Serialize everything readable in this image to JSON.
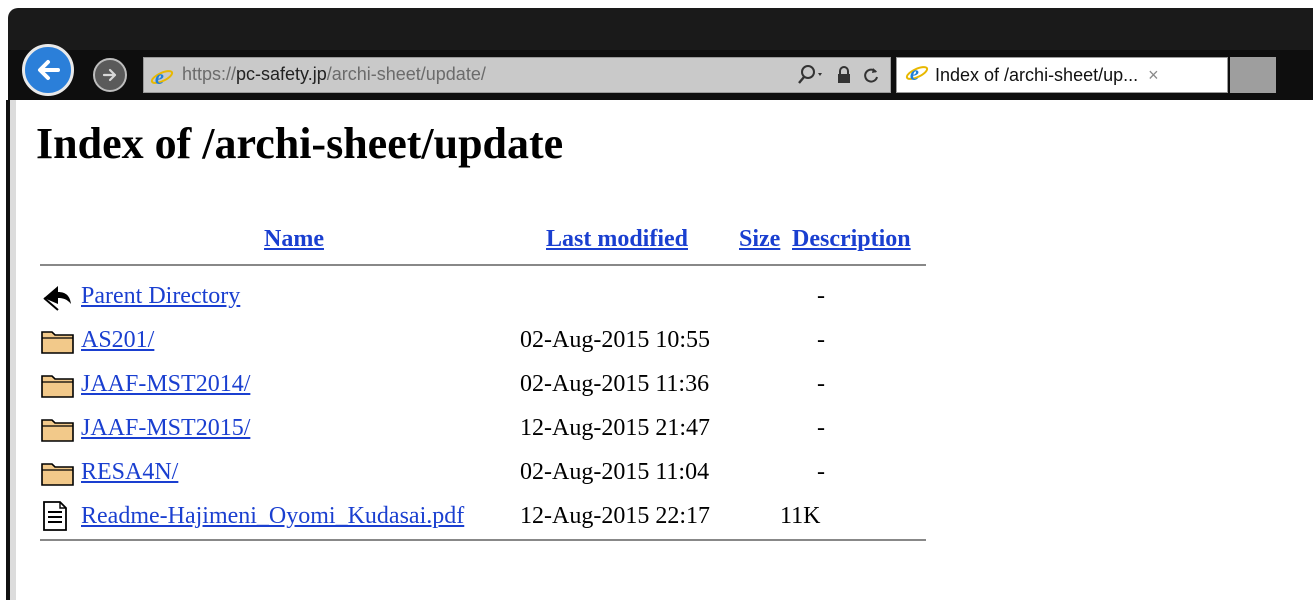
{
  "browser": {
    "address": {
      "scheme": "https://",
      "host": "pc-safety.jp",
      "path": "/archi-sheet/update/"
    },
    "tab": {
      "title": "Index of /archi-sheet/up...",
      "close": "×"
    },
    "icons": {
      "back": "back-arrow-icon",
      "forward": "forward-arrow-icon",
      "site": "ie-logo-icon",
      "search": "search-icon",
      "lock": "lock-icon",
      "refresh": "refresh-icon"
    }
  },
  "page": {
    "title": "Index of /archi-sheet/update",
    "columns": {
      "name": "Name",
      "last_modified": "Last modified",
      "size": "Size",
      "description": "Description"
    },
    "entries": [
      {
        "icon": "parent-directory-icon",
        "name": "Parent Directory",
        "modified": "",
        "size": "-"
      },
      {
        "icon": "folder-icon",
        "name": "AS201/",
        "modified": "02-Aug-2015 10:55",
        "size": "-"
      },
      {
        "icon": "folder-icon",
        "name": "JAAF-MST2014/",
        "modified": "02-Aug-2015 11:36",
        "size": "-"
      },
      {
        "icon": "folder-icon",
        "name": "JAAF-MST2015/",
        "modified": "12-Aug-2015 21:47",
        "size": "-"
      },
      {
        "icon": "folder-icon",
        "name": "RESA4N/",
        "modified": "02-Aug-2015 11:04",
        "size": "-"
      },
      {
        "icon": "file-icon",
        "name": "Readme-Hajimeni_Oyomi_Kudasai.pdf",
        "modified": "12-Aug-2015 22:17",
        "size": "11K"
      }
    ]
  },
  "colors": {
    "link": "#1a3fd0",
    "chrome_dark": "#0e0e0e",
    "back_button": "#2b7fd9"
  }
}
